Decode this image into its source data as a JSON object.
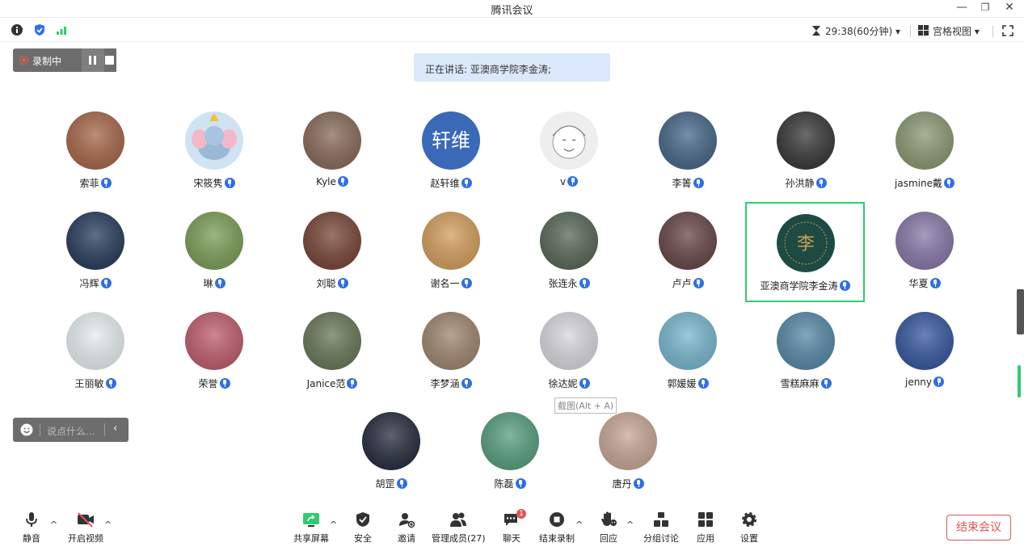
{
  "window": {
    "title": "腾讯会议",
    "min": "—",
    "restore": "❐",
    "close": "✕"
  },
  "topbar": {
    "timer": "29:38(60分钟)",
    "layout_label": "宫格视图"
  },
  "recording": {
    "label": "录制中"
  },
  "speaking": {
    "text": "正在讲话: 亚澳商学院李金涛;"
  },
  "participants": [
    {
      "name": "索菲",
      "avatar": "photo",
      "color": "#a86a4c"
    },
    {
      "name": "宋筱隽",
      "avatar": "dumbo",
      "color": "#cfe3f2"
    },
    {
      "name": "Kyle",
      "avatar": "photo",
      "color": "#8a6d5c"
    },
    {
      "name": "赵轩维",
      "avatar": "text",
      "text": "轩维",
      "color": "#3a69b8"
    },
    {
      "name": "v",
      "avatar": "sketch",
      "color": "#eeeeee"
    },
    {
      "name": "李箐",
      "avatar": "photo",
      "color": "#4a6a8a"
    },
    {
      "name": "孙洪静",
      "avatar": "photo",
      "color": "#3b3b3b"
    },
    {
      "name": "jasmine戴",
      "avatar": "photo",
      "color": "#8d9a75"
    },
    {
      "name": "冯辉",
      "avatar": "photo",
      "color": "#2c4060"
    },
    {
      "name": "琳",
      "avatar": "photo",
      "color": "#7da05a"
    },
    {
      "name": "刘聪",
      "avatar": "photo",
      "color": "#7a4a3a"
    },
    {
      "name": "谢名一",
      "avatar": "photo",
      "color": "#d4a060"
    },
    {
      "name": "张连永",
      "avatar": "photo",
      "color": "#5a6a5a"
    },
    {
      "name": "卢卢",
      "avatar": "photo",
      "color": "#6a4a4a"
    },
    {
      "name": "亚澳商学院李金涛",
      "avatar": "logo",
      "color": "#1e4a44",
      "highlight": true
    },
    {
      "name": "华夏",
      "avatar": "photo",
      "color": "#8a7aa8"
    },
    {
      "name": "王丽敏",
      "avatar": "photo",
      "color": "#e8eef0"
    },
    {
      "name": "荣誉",
      "avatar": "photo",
      "color": "#c06070"
    },
    {
      "name": "Janice范",
      "avatar": "photo",
      "color": "#6a7a5a"
    },
    {
      "name": "李梦涵",
      "avatar": "photo",
      "color": "#a08870"
    },
    {
      "name": "徐达妮",
      "avatar": "photo",
      "color": "#d8d8e0"
    },
    {
      "name": "郭媛媛",
      "avatar": "photo",
      "color": "#7ab8d0"
    },
    {
      "name": "雪糕麻麻",
      "avatar": "photo",
      "color": "#5a8aa8"
    },
    {
      "name": "jenny",
      "avatar": "photo",
      "color": "#3a5aa0"
    },
    {
      "name": "胡罡",
      "avatar": "photo",
      "color": "#2a3040"
    },
    {
      "name": "陈磊",
      "avatar": "photo",
      "color": "#5aa080"
    },
    {
      "name": "唐丹",
      "avatar": "photo",
      "color": "#c8a898"
    }
  ],
  "chat_input": {
    "placeholder": "说点什么..."
  },
  "tooltip": {
    "text": "截图(Alt + A)"
  },
  "toolbar": {
    "mute": "静音",
    "video": "开启视频",
    "share": "共享屏幕",
    "security": "安全",
    "invite": "邀请",
    "members": "管理成员(27)",
    "chat": "聊天",
    "chat_badge": "1",
    "stop_record": "结束录制",
    "react": "回应",
    "breakout": "分组讨论",
    "apps": "应用",
    "settings": "设置",
    "end_meeting": "结束会议"
  },
  "colors": {
    "accent": "#2f6fe6",
    "highlight": "#2ecc71",
    "end": "#e25555"
  }
}
